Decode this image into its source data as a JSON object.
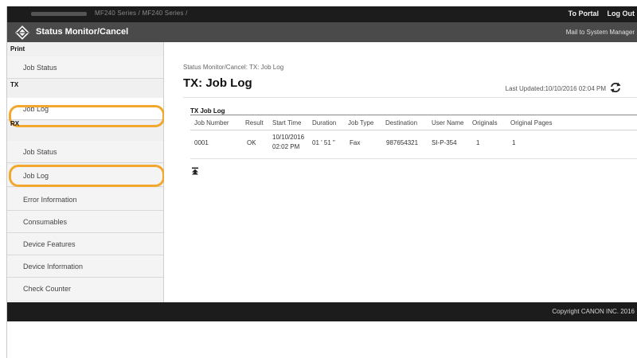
{
  "topbar": {
    "model": "MF240 Series / MF240 Series /",
    "portal_label": "To Portal",
    "logout_label": "Log Out"
  },
  "titlebar": {
    "title": "Status Monitor/Cancel",
    "mail_label": "Mail to System Manager"
  },
  "sidebar": {
    "print_head": "Print",
    "print_job_status": "Job Status",
    "tx_head": "TX",
    "tx_job_log": "Job Log",
    "rx_head": "RX",
    "rx_job_status": "Job Status",
    "rx_job_log": "Job Log",
    "error_info": "Error Information",
    "consumables": "Consumables",
    "device_features": "Device Features",
    "device_info": "Device Information",
    "check_counter": "Check Counter"
  },
  "main": {
    "breadcrumb": "Status Monitor/Cancel: TX: Job Log",
    "title": "TX: Job Log",
    "last_updated": "Last Updated:10/10/2016 02:04 PM",
    "section_label": "TX Job Log",
    "columns": [
      "Job Number",
      "Result",
      "Start Time",
      "Duration",
      "Job Type",
      "Destination",
      "User Name",
      "Originals",
      "Original Pages"
    ],
    "rows": [
      [
        "0001",
        "OK",
        "10/10/2016 02:02 PM",
        "01 ' 51 \"",
        "Fax",
        "987654321",
        "SI-P-354",
        "1",
        "1"
      ]
    ]
  },
  "footer": {
    "copyright": "Copyright CANON INC. 2016"
  },
  "colors": {
    "highlight_ring": "#f2a72e",
    "topbar": "#1c1c1c",
    "titlebar": "#4a4a4a",
    "sidebar_bg": "#f0f0f0"
  },
  "icons": {
    "logo": "status-monitor-logo-icon",
    "refresh": "refresh-icon",
    "back_to_top": "back-to-top-icon"
  }
}
